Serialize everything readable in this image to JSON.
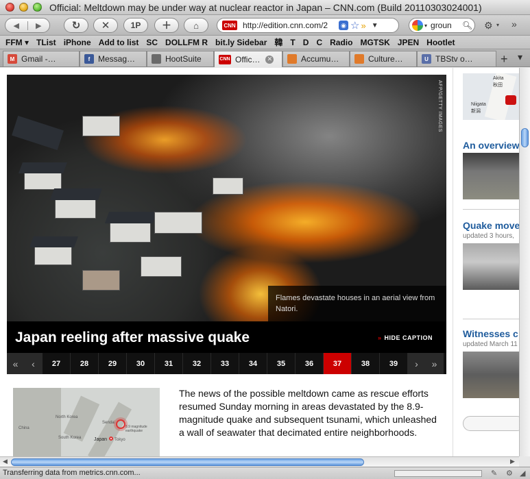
{
  "window": {
    "title": "Official: Meltdown may be under way at nuclear reactor in Japan – CNN.com (Build 20110303024001)"
  },
  "toolbar": {
    "back": "◀",
    "forward": "▶",
    "reload": "↻",
    "stop": "✕",
    "onep": "1P",
    "add": "＋",
    "home": "⌂",
    "url": "http://edition.cnn.com/2",
    "favicon": "CNN",
    "search_value": "groun",
    "search_icon": "magnifier-icon"
  },
  "bookmarks": [
    "FFM ▾",
    "TList",
    "iPhone",
    "Add to list",
    "SC",
    "DOLLFM R",
    "bit.ly Sidebar",
    "韓",
    "T",
    "D",
    "C",
    "Radio",
    "MGTSK",
    "JPEN",
    "Hootlet"
  ],
  "tabs": [
    {
      "label": "Gmail -…",
      "fav": "M",
      "color": "#d6493a"
    },
    {
      "label": "Messag…",
      "fav": "f",
      "color": "#3b5998"
    },
    {
      "label": "HootSuite",
      "fav": "",
      "color": "#6a6a6a"
    },
    {
      "label": "Offic…",
      "fav": "CNN",
      "color": "#cc0000",
      "active": true
    },
    {
      "label": "Accumu…",
      "fav": "",
      "color": "#e07a2a"
    },
    {
      "label": "Culture…",
      "fav": "",
      "color": "#e07a2a"
    },
    {
      "label": "TBStv o…",
      "fav": "U",
      "color": "#5a6fa8"
    }
  ],
  "gallery": {
    "photo_credit": "AFP/GETTY IMAGES",
    "caption": "Flames devastate houses in an aerial view from Natori.",
    "headline": "Japan reeling after massive quake",
    "hide_caption": "HIDE CAPTION",
    "pages": [
      "27",
      "28",
      "29",
      "30",
      "31",
      "32",
      "33",
      "34",
      "35",
      "36",
      "37",
      "38",
      "39"
    ],
    "selected_page": "37",
    "first": "«",
    "prev": "‹",
    "next": "›",
    "last": "»"
  },
  "map": {
    "labels": [
      "China",
      "North Korea",
      "South Korea",
      "Sendai",
      "Japan",
      "Tokyo",
      "8.9 magnitude earthquake"
    ]
  },
  "article": {
    "text": "The news of the possible meltdown came as rescue efforts resumed Sunday morning in areas devastated by the 8.9-magnitude quake and subsequent tsunami, which unleashed a wall of seawater that decimated entire neighborhoods."
  },
  "sidebar": {
    "map_labels": [
      "Akita",
      "秋田",
      "Niigata",
      "新潟"
    ],
    "items": [
      {
        "title": "An overview",
        "meta": ""
      },
      {
        "title": "Quake move",
        "meta": "updated 3 hours,"
      },
      {
        "title": "Witnesses c",
        "meta": "updated March 11"
      }
    ]
  },
  "status": {
    "text": "Transferring data from metrics.cnn.com..."
  },
  "colors": {
    "cnn_red": "#cc0000",
    "link_blue": "#1e5b9c",
    "scroll_blue": "#6fa6e6"
  }
}
